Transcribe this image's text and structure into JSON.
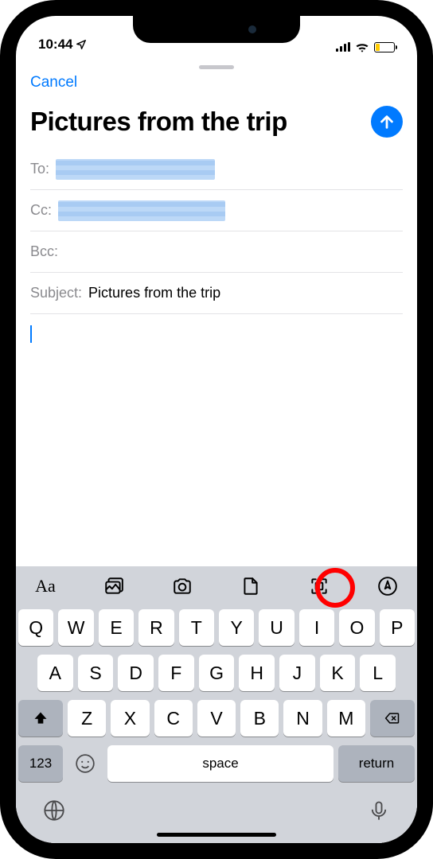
{
  "status": {
    "time": "10:44"
  },
  "nav": {
    "cancel": "Cancel"
  },
  "compose": {
    "title": "Pictures from the trip",
    "to_label": "To:",
    "cc_label": "Cc:",
    "bcc_label": "Bcc:",
    "subject_label": "Subject:",
    "subject_value": "Pictures from the trip"
  },
  "toolbar": {
    "format": "Aa"
  },
  "keyboard": {
    "row1": [
      "Q",
      "W",
      "E",
      "R",
      "T",
      "Y",
      "U",
      "I",
      "O",
      "P"
    ],
    "row2": [
      "A",
      "S",
      "D",
      "F",
      "G",
      "H",
      "J",
      "K",
      "L"
    ],
    "row3": [
      "Z",
      "X",
      "C",
      "V",
      "B",
      "N",
      "M"
    ],
    "numKey": "123",
    "space": "space",
    "return": "return"
  }
}
